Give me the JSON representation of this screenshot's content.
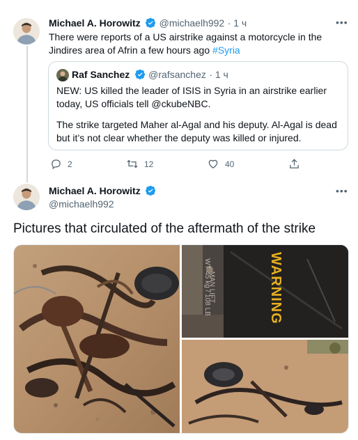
{
  "tweet1": {
    "author": "Michael A. Horowitz",
    "handle": "@michaelh992",
    "time": "· 1 ч",
    "text": "There were reports of a US airstrike against a motorcycle in the Jindires area of Afrin a few hours ago",
    "hashtag": "#Syria",
    "more_icon": "more-icon"
  },
  "quote": {
    "author": "Raf Sanchez",
    "handle": "@rafsanchez",
    "time": "· 1 ч",
    "paragraph1": "NEW: US killed the leader of ISIS in Syria in an airstrike earlier today, US officials tell @ckubeNBC.",
    "paragraph2": "The strike targeted Maher al-Agal and his deputy. Al-Agal is dead but it’s not clear whether the deputy was killed or injured."
  },
  "actions": {
    "replies": "2",
    "retweets": "12",
    "likes": "40"
  },
  "tweet2": {
    "author": "Michael A. Horowitz",
    "handle": "@michaelh992",
    "text": "Pictures that circulated of the aftermath of the strike",
    "more_icon": "more-icon"
  },
  "photo_text": {
    "warning": "WARNING",
    "man_lift": "MAN LIFT",
    "weight": "WT 45 kg / 108 LB"
  },
  "colors": {
    "accent": "#1d9bf0",
    "muted": "#536471",
    "border": "#cfd9de"
  }
}
